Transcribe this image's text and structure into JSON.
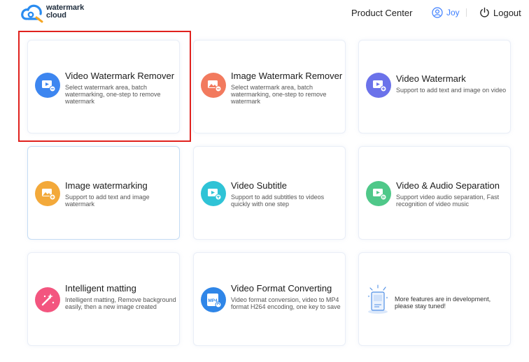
{
  "header": {
    "logo_line1": "watermark",
    "logo_line2": "cloud",
    "product_center": "Product Center",
    "username": "Joy",
    "logout": "Logout"
  },
  "cards": [
    {
      "title": "Video Watermark Remover",
      "desc": "Select watermark area, batch watermarking, one-step to remove watermark",
      "icon": "video-eraser-icon",
      "color": "#3d86f0"
    },
    {
      "title": "Image Watermark Remover",
      "desc": "Select watermark area, batch watermarking, one-step to remove watermark",
      "icon": "image-eraser-icon",
      "color": "#f27a5e"
    },
    {
      "title": "Video Watermark",
      "desc": "Support to add text and image on video",
      "icon": "video-watermark-icon",
      "color": "#6b72ea"
    },
    {
      "title": "Image watermarking",
      "desc": "Support to add text and image watermark",
      "icon": "image-watermark-icon",
      "color": "#f3a93a"
    },
    {
      "title": "Video Subtitle",
      "desc": "Support to add subtitles to videos quickly with one step",
      "icon": "video-subtitle-icon",
      "color": "#2fc3d6"
    },
    {
      "title": "Video & Audio Separation",
      "desc": "Support video audio separation, Fast recognition of video music",
      "icon": "audio-separation-icon",
      "color": "#4fc889"
    },
    {
      "title": "Intelligent matting",
      "desc": "Intelligent matting, Remove background easily, then a new image created",
      "icon": "magic-wand-icon",
      "color": "#f3557f"
    },
    {
      "title": "Video Format Converting",
      "desc": "Video format conversion, video to MP4 format H264 encoding, one key to save",
      "icon": "mp4-file-icon",
      "color": "#2f86e8"
    }
  ],
  "mp4_label": "MP4",
  "dev_card": {
    "text": "More features are in development, please stay tuned!",
    "icon": "development-icon"
  }
}
